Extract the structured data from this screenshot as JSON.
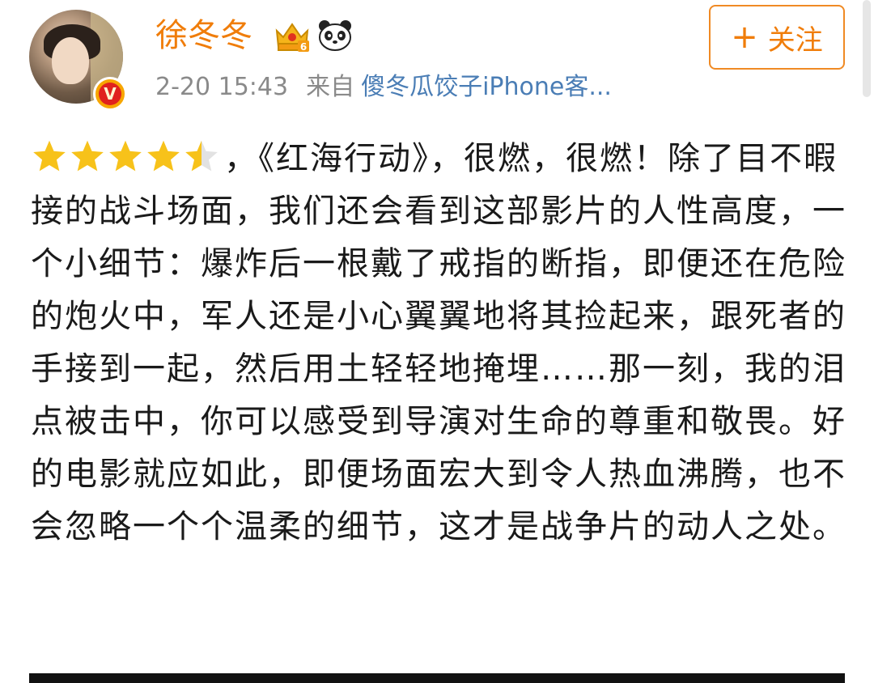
{
  "header": {
    "username": "徐冬冬",
    "timestamp": "2-20 15:43",
    "from_label": "来自",
    "source": "傻冬瓜饺子iPhone客...",
    "follow_button": "关注",
    "follow_plus": "+",
    "verified_badge": "V",
    "level_badge": "6",
    "icons": [
      "crown-icon",
      "panda-icon"
    ]
  },
  "post": {
    "rating": {
      "full_stars": 4,
      "half_stars": 1,
      "out_of": 5
    },
    "text": "，《红海行动》，很燃，很燃！除了目不暇接的战斗场面，我们还会看到这部影片的人性高度，一个小细节：爆炸后一根戴了戒指的断指，即便还在危险的炮火中，军人还是小心翼翼地将其捡起来，跟死者的手接到一起，然后用土轻轻地掩埋……那一刻，我的泪点被击中，你可以感受到导演对生命的尊重和敬畏。好的电影就应如此，即便场面宏大到令人热血沸腾，也不会忽略一个个温柔的细节，这才是战争片的动人之处。"
  },
  "colors": {
    "username": "#f07d0a",
    "meta": "#8a8a8a",
    "source": "#4a7db5",
    "star": "#f7c21a",
    "follow_border": "#f08a24"
  }
}
